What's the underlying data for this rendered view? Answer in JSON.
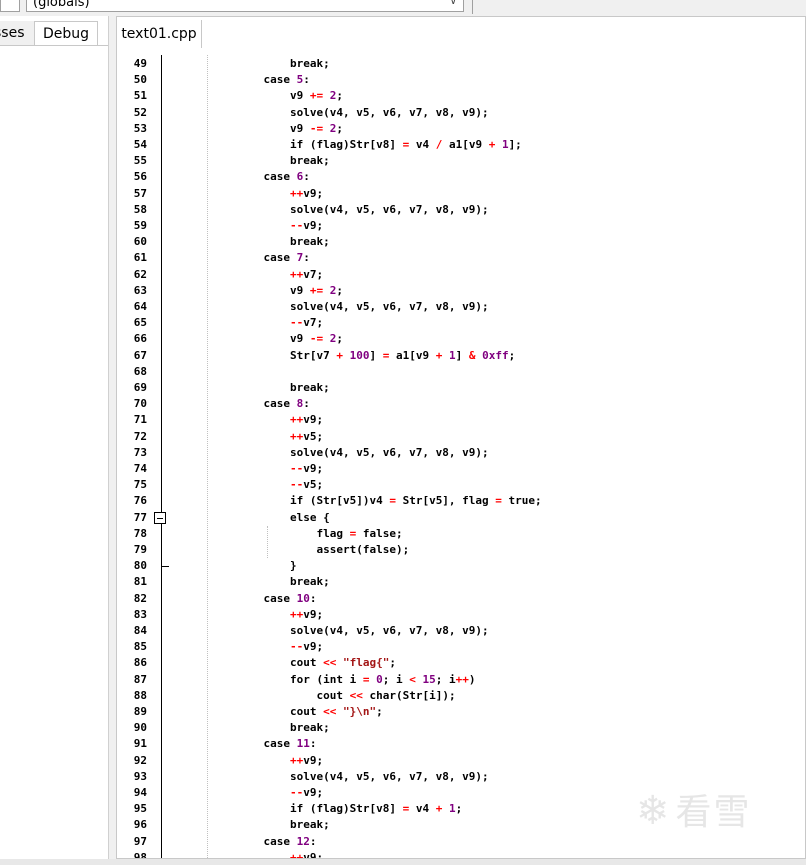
{
  "toolbar": {
    "scope_combo_value": "(globals)"
  },
  "left_panel": {
    "tab_classes": "sses",
    "tab_debug": "Debug"
  },
  "editor": {
    "file_tab": "text01.cpp"
  },
  "watermark": {
    "text": "看雪"
  },
  "code_lines": [
    {
      "n": "49",
      "text": "        break;"
    },
    {
      "n": "50",
      "text": "    case 5:"
    },
    {
      "n": "51",
      "text": "        v9 += 2;"
    },
    {
      "n": "52",
      "text": "        solve(v4, v5, v6, v7, v8, v9);"
    },
    {
      "n": "53",
      "text": "        v9 -= 2;"
    },
    {
      "n": "54",
      "text": "        if (flag)Str[v8] = v4 / a1[v9 + 1];"
    },
    {
      "n": "55",
      "text": "        break;"
    },
    {
      "n": "56",
      "text": "    case 6:"
    },
    {
      "n": "57",
      "text": "        ++v9;"
    },
    {
      "n": "58",
      "text": "        solve(v4, v5, v6, v7, v8, v9);"
    },
    {
      "n": "59",
      "text": "        --v9;"
    },
    {
      "n": "60",
      "text": "        break;"
    },
    {
      "n": "61",
      "text": "    case 7:"
    },
    {
      "n": "62",
      "text": "        ++v7;"
    },
    {
      "n": "63",
      "text": "        v9 += 2;"
    },
    {
      "n": "64",
      "text": "        solve(v4, v5, v6, v7, v8, v9);"
    },
    {
      "n": "65",
      "text": "        --v7;"
    },
    {
      "n": "66",
      "text": "        v9 -= 2;"
    },
    {
      "n": "67",
      "text": "        Str[v7 + 100] = a1[v9 + 1] & 0xff;"
    },
    {
      "n": "68",
      "text": ""
    },
    {
      "n": "69",
      "text": "        break;"
    },
    {
      "n": "70",
      "text": "    case 8:"
    },
    {
      "n": "71",
      "text": "        ++v9;"
    },
    {
      "n": "72",
      "text": "        ++v5;"
    },
    {
      "n": "73",
      "text": "        solve(v4, v5, v6, v7, v8, v9);"
    },
    {
      "n": "74",
      "text": "        --v9;"
    },
    {
      "n": "75",
      "text": "        --v5;"
    },
    {
      "n": "76",
      "text": "        if (Str[v5])v4 = Str[v5], flag = true;"
    },
    {
      "n": "77",
      "text": "        else {"
    },
    {
      "n": "78",
      "text": "            flag = false;"
    },
    {
      "n": "79",
      "text": "            assert(false);"
    },
    {
      "n": "80",
      "text": "        }"
    },
    {
      "n": "81",
      "text": "        break;"
    },
    {
      "n": "82",
      "text": "    case 10:"
    },
    {
      "n": "83",
      "text": "        ++v9;"
    },
    {
      "n": "84",
      "text": "        solve(v4, v5, v6, v7, v8, v9);"
    },
    {
      "n": "85",
      "text": "        --v9;"
    },
    {
      "n": "86",
      "text": "        cout << \"flag{\";"
    },
    {
      "n": "87",
      "text": "        for (int i = 0; i < 15; i++)"
    },
    {
      "n": "88",
      "text": "            cout << char(Str[i]);"
    },
    {
      "n": "89",
      "text": "        cout << \"}\\n\";"
    },
    {
      "n": "90",
      "text": "        break;"
    },
    {
      "n": "91",
      "text": "    case 11:"
    },
    {
      "n": "92",
      "text": "        ++v9;"
    },
    {
      "n": "93",
      "text": "        solve(v4, v5, v6, v7, v8, v9);"
    },
    {
      "n": "94",
      "text": "        --v9;"
    },
    {
      "n": "95",
      "text": "        if (flag)Str[v8] = v4 + 1;"
    },
    {
      "n": "96",
      "text": "        break;"
    },
    {
      "n": "97",
      "text": "    case 12:"
    },
    {
      "n": "98",
      "text": "        ++v9;"
    }
  ]
}
